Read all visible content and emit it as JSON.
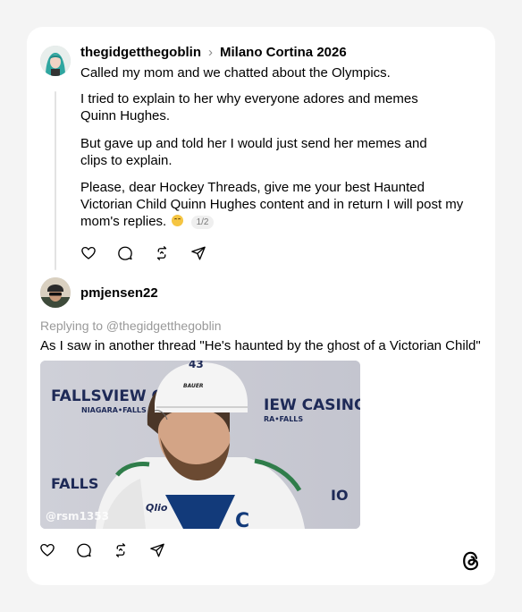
{
  "post": {
    "username": "thegidgetthegoblin",
    "separator_icon": "chevron-right-icon",
    "topic": "Milano Cortina 2026",
    "lines": [
      "Called my mom and we chatted about the Olympics.",
      "I tried to explain to her why everyone adores and memes Quinn Hughes.",
      "But gave up and told her I would just send her memes and clips to explain.",
      "Please, dear Hockey Threads, give me your best Haunted Victorian Child Quinn Hughes content and in return I will post my mom's replies."
    ],
    "emoji": "laughing-emoji",
    "page_indicator": "1/2"
  },
  "reply": {
    "username": "pmjensen22",
    "replying_to": "Replying to @thegidgetthegoblin",
    "text": "As I saw in another thread \"He's haunted by the ghost of a Victorian Child\"",
    "media": {
      "sign_left": "FALLSVIEW CA",
      "sign_left_sub": "NIAGARA•FALLS",
      "sign_right": "IEW CASINO",
      "sign_right_sub": "RA•FALLS",
      "bottom_left": "FALLS",
      "bottom_right": "IO",
      "helmet_number": "43",
      "helmet_brand": "BAUER",
      "jersey_letter": "C",
      "sponsor": "Qlio",
      "watermark": "@rsm1353"
    }
  },
  "actions": [
    "heart-icon",
    "comment-icon",
    "repost-icon",
    "share-icon"
  ],
  "brand_icon": "threads-logo-icon",
  "colors": {
    "background": "#f4f4f4",
    "card": "#ffffff",
    "muted_text": "#999999",
    "thread_line": "#e3e3e3"
  }
}
